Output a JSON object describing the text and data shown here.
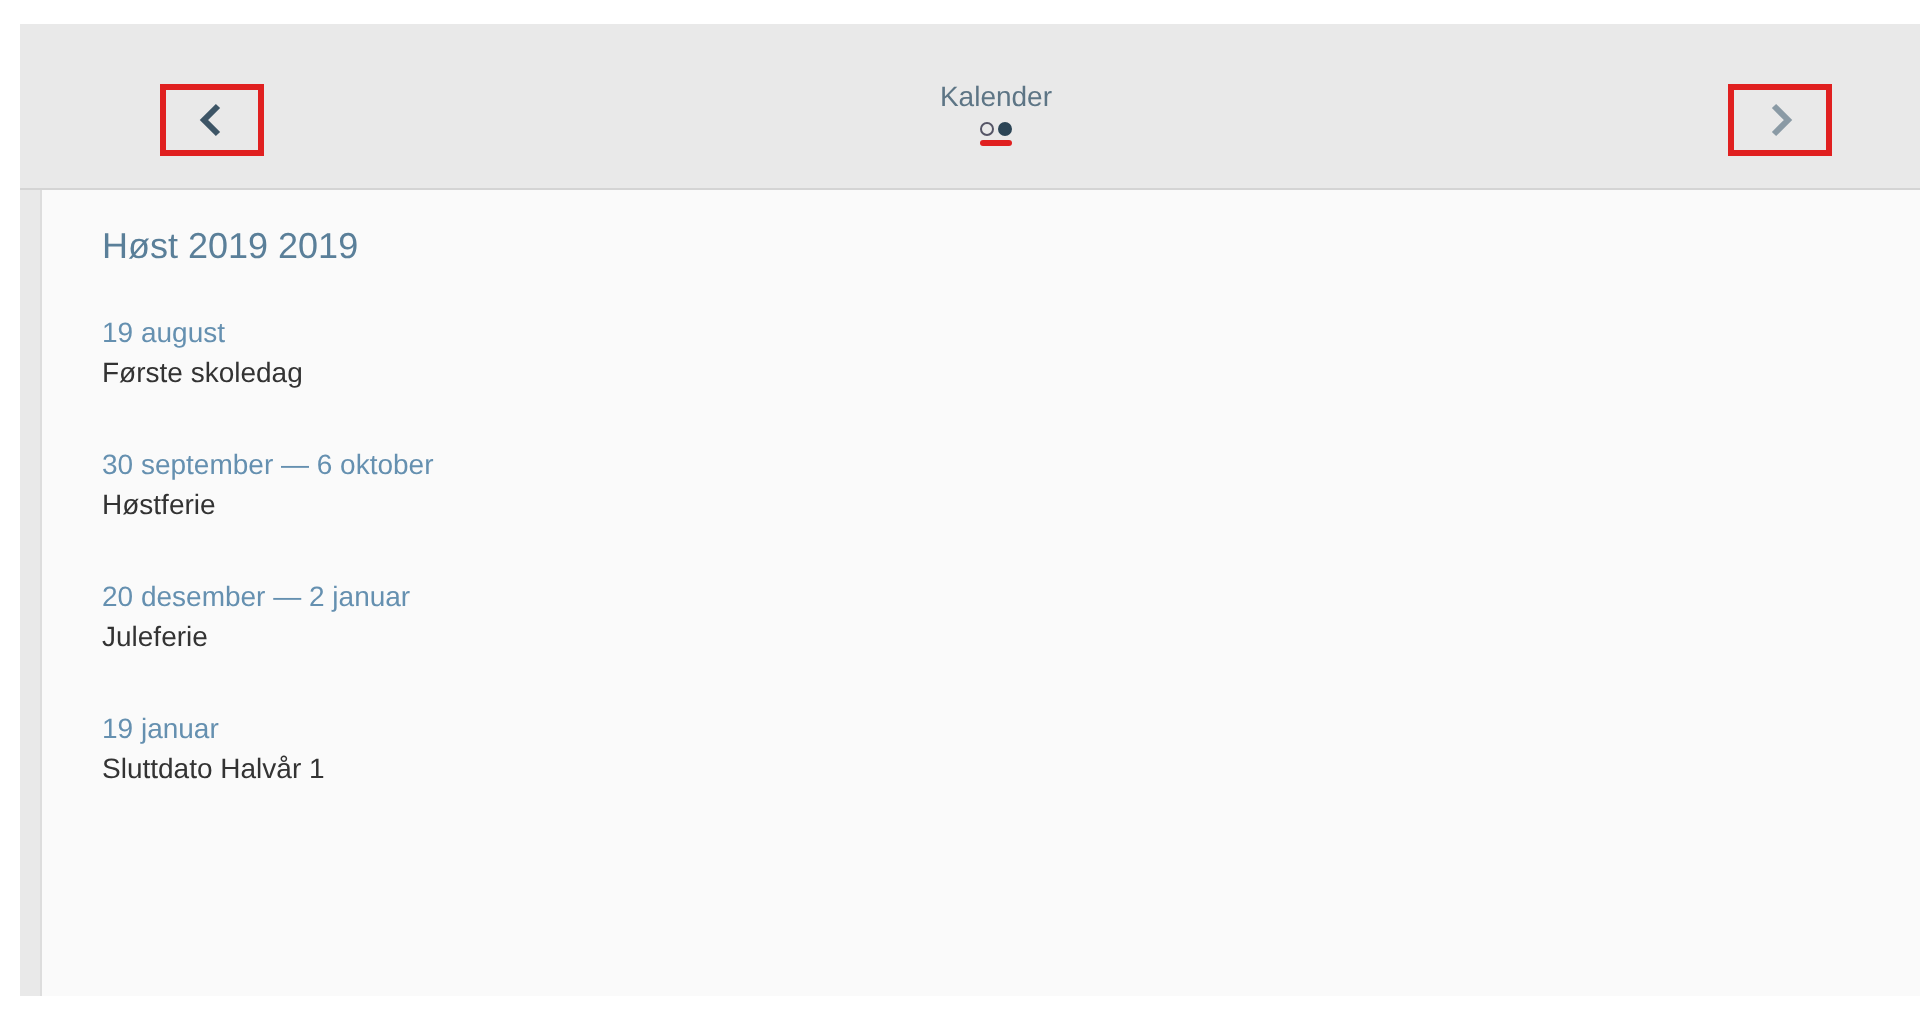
{
  "header": {
    "title": "Kalender",
    "pages": [
      {
        "selected": false
      },
      {
        "selected": true
      }
    ],
    "prev_highlighted": true,
    "next_highlighted": true
  },
  "calendar": {
    "heading": "Høst 2019 2019",
    "events": [
      {
        "date": "19 august",
        "title": "Første skoledag"
      },
      {
        "date": "30 september — 6 oktober",
        "title": "Høstferie"
      },
      {
        "date": "20 desember — 2 januar",
        "title": "Juleferie"
      },
      {
        "date": "19 januar",
        "title": "Sluttdato Halvår 1"
      }
    ]
  }
}
